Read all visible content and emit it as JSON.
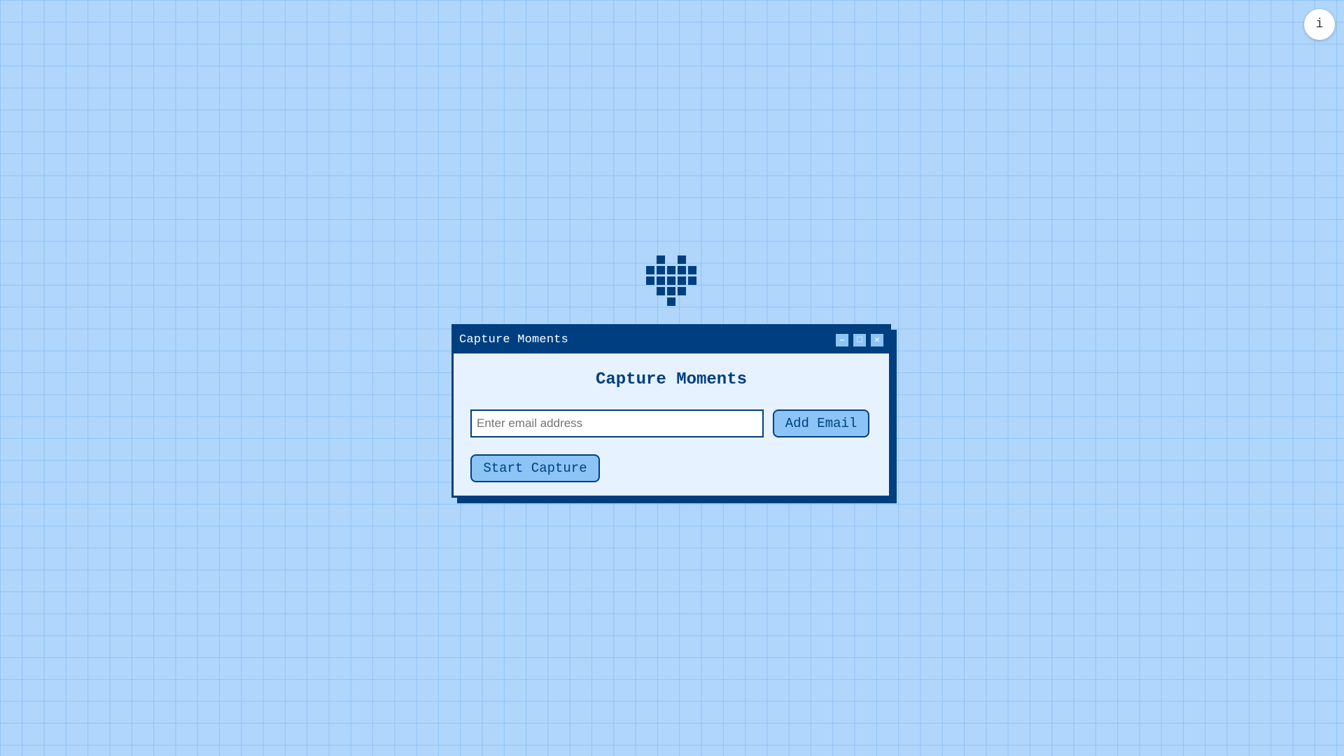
{
  "info_button": {
    "label": "i"
  },
  "window": {
    "title": "Capture Moments",
    "controls": {
      "minimize": "–",
      "maximize": "□",
      "close": "✕"
    }
  },
  "main": {
    "heading": "Capture Moments",
    "email_input": {
      "value": "",
      "placeholder": "Enter email address"
    },
    "add_email_label": "Add Email",
    "start_capture_label": "Start Capture"
  },
  "colors": {
    "background": "#b0d6fc",
    "accent": "#003f7f",
    "button": "#8cc4f6",
    "window_body": "#e6f2ff"
  },
  "icons": {
    "logo": "pixel-heart-icon",
    "info": "info-icon"
  }
}
